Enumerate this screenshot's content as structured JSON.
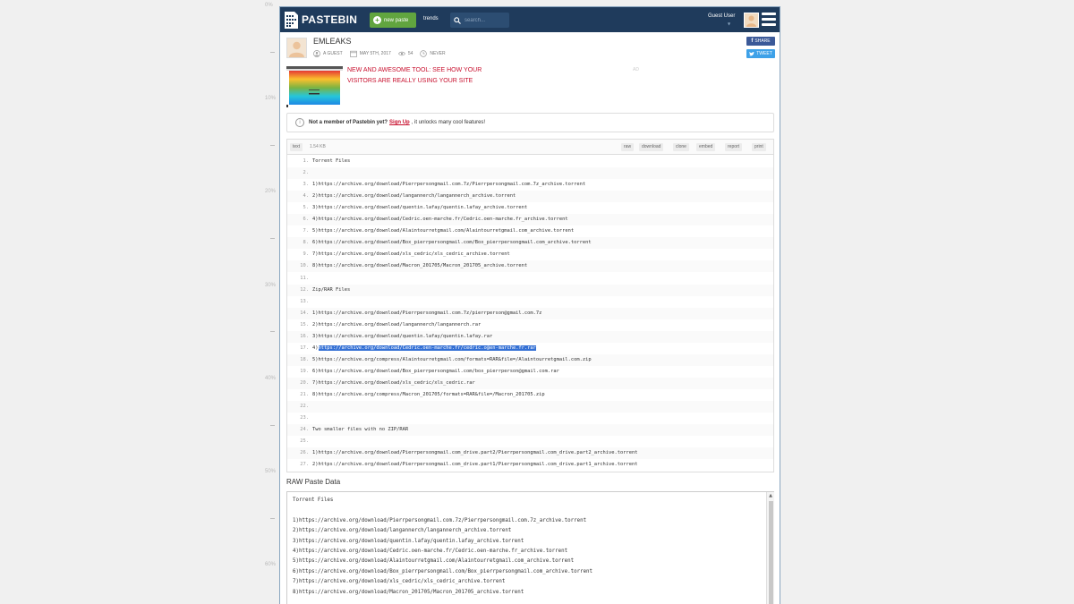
{
  "ruler": [
    "0%",
    "10%",
    "20%",
    "30%",
    "40%",
    "50%",
    "60%"
  ],
  "header": {
    "logo_text": "PASTEBIN",
    "new_paste": "new paste",
    "trends": "trends",
    "search_placeholder": "search...",
    "user": "Guest User"
  },
  "paste": {
    "title": "EMLEAKS",
    "author": "A GUEST",
    "date": "MAY 5TH, 2017",
    "views": "54",
    "expire": "NEVER"
  },
  "social": {
    "share": "SHARE",
    "tweet": "TWEET"
  },
  "ad": {
    "text": "NEW AND AWESOME TOOL: SEE HOW YOUR VISITORS ARE REALLY USING YOUR SITE",
    "label": "AD"
  },
  "notice": {
    "lead": "Not a member of Pastebin yet?",
    "link": "Sign Up",
    "rest": ", it unlocks many cool features!"
  },
  "toolbar": {
    "syntax": "text",
    "size": "1.54 KB",
    "buttons": [
      "raw",
      "download",
      "clone",
      "embed",
      "report",
      "print"
    ]
  },
  "code": [
    {
      "n": "1.",
      "t": "Torrent Files"
    },
    {
      "n": "2.",
      "t": ""
    },
    {
      "n": "3.",
      "t": "1)https://archive.org/download/Pierrpersongmail.com.7z/Pierrpersongmail.com.7z_archive.torrent"
    },
    {
      "n": "4.",
      "t": "2)https://archive.org/download/langannerch/langannerch_archive.torrent"
    },
    {
      "n": "5.",
      "t": "3)https://archive.org/download/quentin.lafay/quentin.lafay_archive.torrent"
    },
    {
      "n": "6.",
      "t": "4)https://archive.org/download/Cedric.oen-marche.fr/Cedric.oen-marche.fr_archive.torrent"
    },
    {
      "n": "7.",
      "t": "5)https://archive.org/download/Alaintourretgmail.com/Alaintourretgmail.com_archive.torrent"
    },
    {
      "n": "8.",
      "t": "6)https://archive.org/download/Box_pierrpersongmail.com/Box_pierrpersongmail.com_archive.torrent"
    },
    {
      "n": "9.",
      "t": "7)https://archive.org/download/xls_cedric/xls_cedric_archive.torrent"
    },
    {
      "n": "10.",
      "t": "8)https://archive.org/download/Macron_201705/Macron_201705_archive.torrent"
    },
    {
      "n": "11.",
      "t": ""
    },
    {
      "n": "12.",
      "t": "Zip/RAR Files"
    },
    {
      "n": "13.",
      "t": ""
    },
    {
      "n": "14.",
      "t": "1)https://archive.org/download/Pierrpersongmail.com.7z/pierrperson@gmail.com.7z"
    },
    {
      "n": "15.",
      "t": "2)https://archive.org/download/langannerch/langannerch.rar"
    },
    {
      "n": "16.",
      "t": "3)https://archive.org/download/quentin.lafay/quentin.lafay.rar"
    },
    {
      "n": "17.",
      "t": "4)",
      "hl": "https://archive.org/download/Cedric.oen-marche.fr/cedric.o@en-marche.fr.rar"
    },
    {
      "n": "18.",
      "t": "5)https://archive.org/compress/Alaintourretgmail.com/formats=RAR&file=/Alaintourretgmail.com.zip"
    },
    {
      "n": "19.",
      "t": "6)https://archive.org/download/Box_pierrpersongmail.com/box_pierrperson@gmail.com.rar"
    },
    {
      "n": "20.",
      "t": "7)https://archive.org/download/xls_cedric/xls_cedric.rar"
    },
    {
      "n": "21.",
      "t": "8)https://archive.org/compress/Macron_201705/formats=RAR&file=/Macron_201705.zip"
    },
    {
      "n": "22.",
      "t": ""
    },
    {
      "n": "23.",
      "t": ""
    },
    {
      "n": "24.",
      "t": "Two smaller files with no ZIP/RAR"
    },
    {
      "n": "25.",
      "t": ""
    },
    {
      "n": "26.",
      "t": "1)https://archive.org/download/Pierrpersongmail.com_drive.part2/Pierrpersongmail.com_drive.part2_archive.torrent"
    },
    {
      "n": "27.",
      "t": "2)https://archive.org/download/Pierrpersongmail.com_drive.part1/Pierrpersongmail.com_drive.part1_archive.torrent"
    }
  ],
  "raw": {
    "title": "RAW Paste Data",
    "lines": [
      "Torrent Files",
      "",
      "1)https://archive.org/download/Pierrpersongmail.com.7z/Pierrpersongmail.com.7z_archive.torrent",
      "2)https://archive.org/download/langannerch/langannerch_archive.torrent",
      "3)https://archive.org/download/quentin.lafay/quentin.lafay_archive.torrent",
      "4)https://archive.org/download/Cedric.oen-marche.fr/Cedric.oen-marche.fr_archive.torrent",
      "5)https://archive.org/download/Alaintourretgmail.com/Alaintourretgmail.com_archive.torrent",
      "6)https://archive.org/download/Box_pierrpersongmail.com/Box_pierrpersongmail.com_archive.torrent",
      "7)https://archive.org/download/xls_cedric/xls_cedric_archive.torrent",
      "8)https://archive.org/download/Macron_201705/Macron_201705_archive.torrent"
    ]
  }
}
